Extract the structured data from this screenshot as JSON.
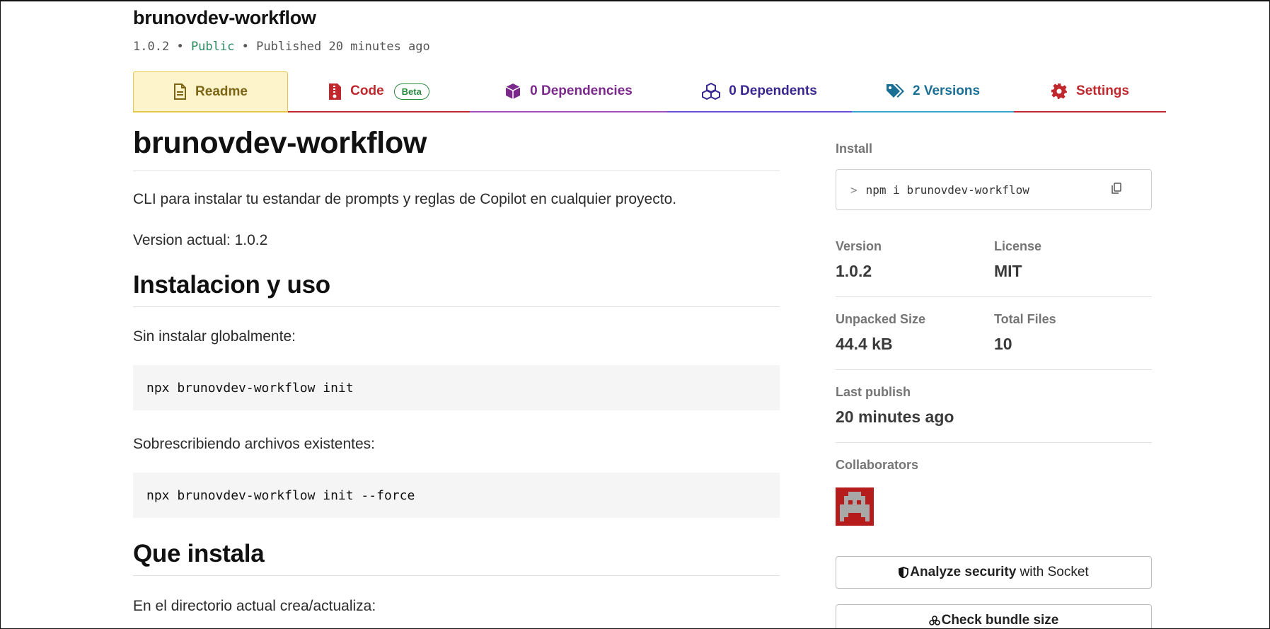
{
  "package": {
    "name": "brunovdev-workflow",
    "version": "1.0.2",
    "sep": "•",
    "visibility": "Public",
    "published": "Published 20 minutes ago"
  },
  "tabs": {
    "readme": "Readme",
    "code": "Code",
    "code_badge": "Beta",
    "dependencies": "0 Dependencies",
    "dependents": "0 Dependents",
    "versions": "2 Versions",
    "settings": "Settings"
  },
  "readme": {
    "title": "brunovdev-workflow",
    "description": "CLI para instalar tu estandar de prompts y reglas de Copilot en cualquier proyecto.",
    "version_line": "Version actual: 1.0.2",
    "section1_title": "Instalacion y uso",
    "section1_p1": "Sin instalar globalmente:",
    "code1": "npx brunovdev-workflow init",
    "section1_p2": "Sobrescribiendo archivos existentes:",
    "code2": "npx brunovdev-workflow init --force",
    "section2_title": "Que instala",
    "section2_p1": "En el directorio actual crea/actualiza:"
  },
  "sidebar": {
    "install_label": "Install",
    "install_prompt": ">",
    "install_cmd": "npm i brunovdev-workflow",
    "version_label": "Version",
    "version_value": "1.0.2",
    "license_label": "License",
    "license_value": "MIT",
    "unpacked_label": "Unpacked Size",
    "unpacked_value": "44.4 kB",
    "files_label": "Total Files",
    "files_value": "10",
    "last_publish_label": "Last publish",
    "last_publish_value": "20 minutes ago",
    "collaborators_label": "Collaborators",
    "socket_bold": "Analyze security",
    "socket_rest": " with Socket",
    "bundle_bold": "Check bundle size"
  },
  "colors": {
    "readme_tab": "#fdf4cc",
    "code_tab": "#c0282d",
    "deps_tab": "#7b2a8c",
    "dependents_tab": "#3a2690",
    "versions_tab": "#1a6f94",
    "settings_tab": "#c0282d",
    "public": "#2a8a60",
    "avatar_bg": "#b71c1c"
  },
  "icons": {
    "readme": "document-icon",
    "code": "code-file-icon",
    "dependencies": "box-icon",
    "dependents": "boxes-icon",
    "versions": "tags-icon",
    "settings": "gear-icon",
    "copy": "copy-icon",
    "socket": "shield-icon",
    "bundle": "bundle-icon"
  }
}
